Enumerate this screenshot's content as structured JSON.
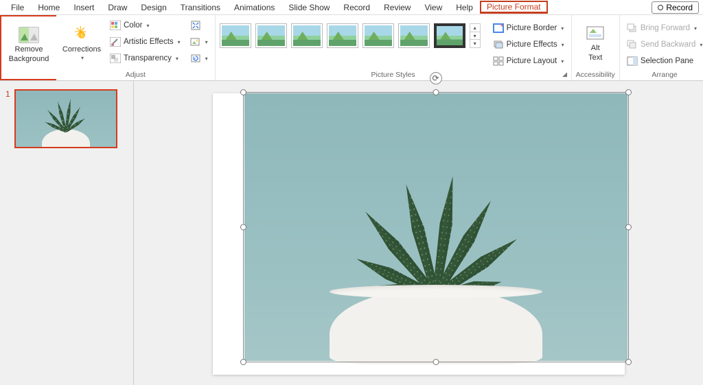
{
  "menu": {
    "items": [
      "File",
      "Home",
      "Insert",
      "Draw",
      "Design",
      "Transitions",
      "Animations",
      "Slide Show",
      "Record",
      "Review",
      "View",
      "Help",
      "Picture Format"
    ],
    "active": "Picture Format",
    "record_button": "Record"
  },
  "ribbon": {
    "remove_bg": {
      "line1": "Remove",
      "line2": "Background"
    },
    "corrections": "Corrections",
    "adjust": {
      "color": "Color",
      "artistic": "Artistic Effects",
      "transparency": "Transparency",
      "group_label": "Adjust"
    },
    "styles_label": "Picture Styles",
    "picture": {
      "border": "Picture Border",
      "effects": "Picture Effects",
      "layout": "Picture Layout"
    },
    "alt_text": {
      "line1": "Alt",
      "line2": "Text",
      "group_label": "Accessibility"
    },
    "arrange": {
      "bring_forward": "Bring Forward",
      "send_backward": "Send Backward",
      "selection_pane": "Selection Pane",
      "group_label": "Arrange"
    }
  },
  "slides": {
    "current_number": "1"
  }
}
